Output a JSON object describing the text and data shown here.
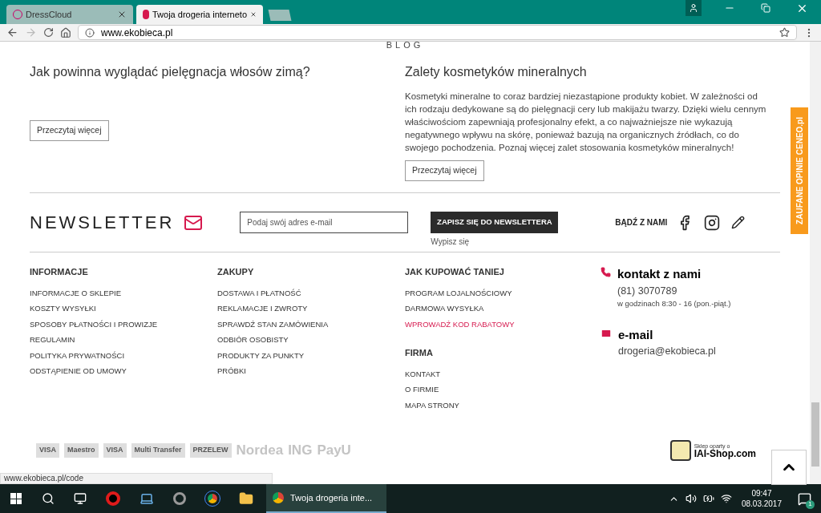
{
  "browser": {
    "tabs": [
      {
        "title": "DressCloud",
        "selected": false
      },
      {
        "title": "Twoja drogeria interneto",
        "selected": true
      }
    ],
    "url": "www.ekobieca.pl"
  },
  "blog": {
    "heading": "BLOG",
    "posts": [
      {
        "title": "Jak powinna wyglądać pielęgnacja włosów zimą?",
        "button": "Przeczytaj więcej"
      },
      {
        "title": "Zalety kosmetyków mineralnych",
        "excerpt": "Kosmetyki mineralne to coraz bardziej niezastąpione produkty kobiet. W zależności od ich rodzaju dedykowane są do pielęgnacji cery lub makijażu twarzy. Dzięki wielu cennym właściwościom zapewniają profesjonalny efekt, a co najważniejsze nie wykazują negatywnego wpływu na skórę, ponieważ bazują na organicznych źródłach, co do swojego pochodzenia. Poznaj więcej zalet stosowania kosmetyków mineralnych!",
        "button": "Przeczytaj więcej"
      }
    ]
  },
  "newsletter": {
    "title": "NEWSLETTER",
    "placeholder": "Podaj swój adres e-mail",
    "button": "ZAPISZ SIĘ DO NEWSLETTERA",
    "unsubscribe": "Wypisz się",
    "social_label": "BĄDŹ Z NAMI"
  },
  "ceneo_badge": "ZAUFANE OPINIE CENEO.pl",
  "footer_columns": [
    [
      {
        "heading": "INFORMACJE",
        "links": [
          {
            "label": "INFORMACJE O SKLEPIE",
            "highlighted": false
          },
          {
            "label": "KOSZTY WYSYŁKI",
            "highlighted": false
          },
          {
            "label": "SPOSOBY PŁATNOŚCI I PROWIZJE",
            "highlighted": false
          },
          {
            "label": "REGULAMIN",
            "highlighted": false
          },
          {
            "label": "POLITYKA PRYWATNOŚCI",
            "highlighted": false
          },
          {
            "label": "ODSTĄPIENIE OD UMOWY",
            "highlighted": false
          }
        ]
      }
    ],
    [
      {
        "heading": "ZAKUPY",
        "links": [
          {
            "label": "DOSTAWA I PŁATNOŚĆ",
            "highlighted": false
          },
          {
            "label": "REKLAMACJE I ZWROTY",
            "highlighted": false
          },
          {
            "label": "SPRAWDŹ STAN ZAMÓWIENIA",
            "highlighted": false
          },
          {
            "label": "ODBIÓR OSOBISTY",
            "highlighted": false
          },
          {
            "label": "PRODUKTY ZA PUNKTY",
            "highlighted": false
          },
          {
            "label": "PRÓBKI",
            "highlighted": false
          }
        ]
      }
    ],
    [
      {
        "heading": "JAK KUPOWAĆ TANIEJ",
        "links": [
          {
            "label": "PROGRAM LOJALNOŚCIOWY",
            "highlighted": false
          },
          {
            "label": "DARMOWA WYSYŁKA",
            "highlighted": false
          },
          {
            "label": "WPROWADŹ KOD RABATOWY",
            "highlighted": true
          }
        ]
      },
      {
        "heading": "FIRMA",
        "links": [
          {
            "label": "KONTAKT",
            "highlighted": false
          },
          {
            "label": "O FIRMIE",
            "highlighted": false
          },
          {
            "label": "MAPA STRONY",
            "highlighted": false
          }
        ]
      }
    ]
  ],
  "contact": [
    {
      "kind": "phone",
      "heading": "kontakt z nami",
      "value": "(81) 3070789",
      "note": "w godzinach 8:30 - 16 (pon.-piąt.)"
    },
    {
      "kind": "email",
      "heading": "e-mail",
      "value": "drogeria@ekobieca.pl"
    }
  ],
  "payment_logos": [
    "VISA",
    "Maestro",
    "VISA",
    "Multi Transfer",
    "PRZELEW",
    "Nordea",
    "ING",
    "PayU"
  ],
  "platform_badge": {
    "caption": "Sklep oparty o",
    "name": "IAI-Shop.com"
  },
  "status_url": "www.ekobieca.pl/code",
  "taskbar": {
    "active_window": "Twoja drogeria inte...",
    "time": "09:47",
    "date": "08.03.2017",
    "notifications": "1"
  }
}
